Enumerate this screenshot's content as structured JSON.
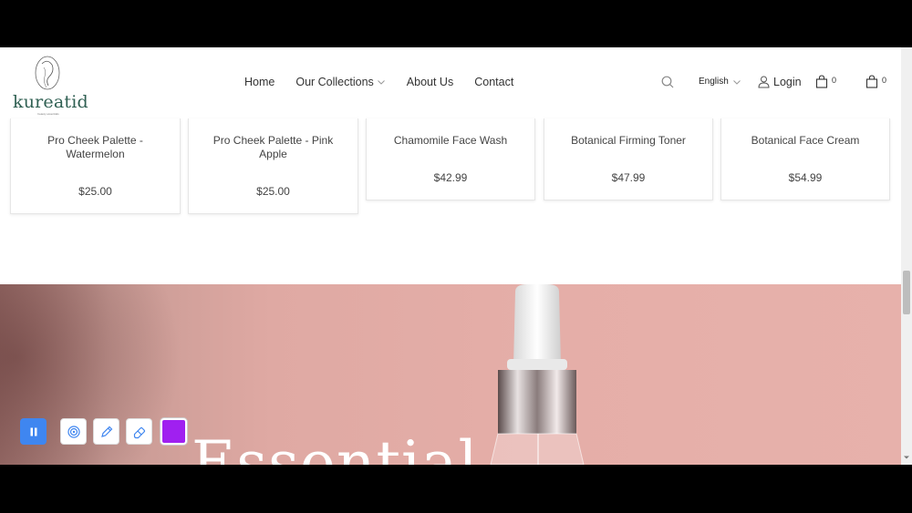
{
  "header": {
    "logo_text": "kureatid",
    "logo_tagline": "beauty essentials",
    "nav": [
      {
        "label": "Home"
      },
      {
        "label": "Our Collections"
      },
      {
        "label": "About Us"
      },
      {
        "label": "Contact"
      }
    ],
    "language": "English",
    "login_label": "Login",
    "cart_count_1": "0",
    "cart_count_2": "0"
  },
  "products": [
    {
      "name": "Pro Cheek Palette - Watermelon",
      "price": "$25.00"
    },
    {
      "name": "Pro Cheek Palette - Pink Apple",
      "price": "$25.00"
    },
    {
      "name": "Chamomile Face Wash",
      "price": "$42.99"
    },
    {
      "name": "Botanical Firming Toner",
      "price": "$47.99"
    },
    {
      "name": "Botanical Face Cream",
      "price": "$54.99"
    }
  ],
  "hero": {
    "title": "Essential"
  },
  "toolbar": {
    "active_color": "#a020f0",
    "accent": "#3f86f0"
  },
  "icons": {
    "search": "search-icon",
    "user": "user-icon",
    "bag": "shopping-bag-icon",
    "pause": "pause-icon",
    "target": "target-icon",
    "pen": "pen-icon",
    "eraser": "eraser-icon"
  }
}
